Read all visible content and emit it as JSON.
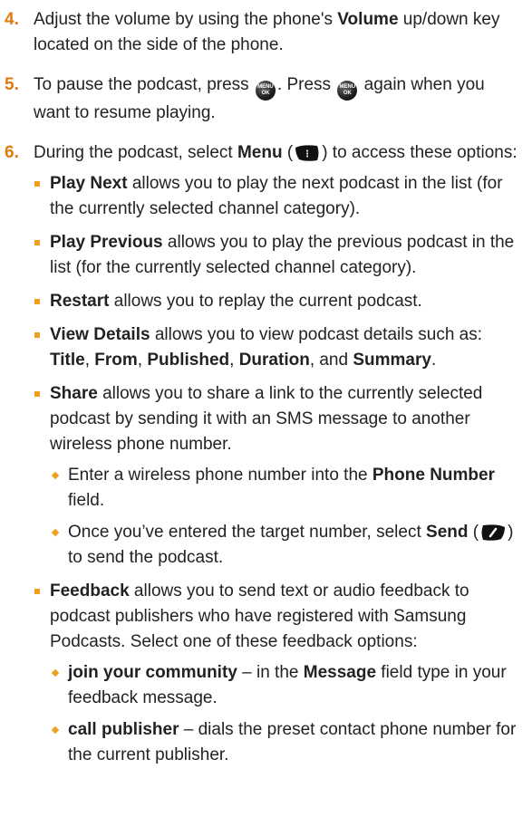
{
  "steps": [
    {
      "number": "4.",
      "pre": "Adjust the volume by using the phone's ",
      "bold": "Volume",
      "post": " up/down key located on the side of the phone."
    },
    {
      "number": "5.",
      "pre": "To pause the podcast, press ",
      "mid": ". Press ",
      "post": " again when you want to resume playing."
    },
    {
      "number": "6.",
      "pre": "During the podcast, select ",
      "bold": "Menu",
      "open": " (",
      "close": ") to access these options:"
    }
  ],
  "menu_key": {
    "line1": "MENU",
    "line2": "OK",
    "icon": "menu-ok-key-icon"
  },
  "softkey_icons": {
    "right": "right-softkey-icon",
    "left": "left-softkey-icon"
  },
  "options": [
    {
      "title": "Play Next",
      "text": " allows you to play the next podcast in the list (for the currently selected channel category)."
    },
    {
      "title": "Play Previous",
      "text": " allows you to play the previous podcast in the list (for the currently selected channel category)."
    },
    {
      "title": "Restart",
      "text": " allows you to replay the current podcast."
    },
    {
      "title": "View Details",
      "text": " allows you to view podcast details such as: ",
      "fields": [
        "Title",
        "From",
        "Published",
        "Duration",
        "Summary"
      ],
      "sep": ", ",
      "and": ", and ",
      "end": "."
    },
    {
      "title": "Share",
      "text": " allows you to share a link to the currently selected podcast by sending it with an SMS message to another wireless phone number.",
      "subs": [
        {
          "pre": "Enter a wireless phone number into the ",
          "bold": "Phone Number",
          "post": " field."
        },
        {
          "pre": "Once you’ve entered the target number, select ",
          "bold": "Send",
          "open": " (",
          "close": ") to send the podcast."
        }
      ]
    },
    {
      "title": "Feedback",
      "text": " allows you to send text or audio feedback to podcast publishers who have registered with Samsung Podcasts. Select one of these feedback options:",
      "subs": [
        {
          "bold": "join your community",
          "mid": " – in the ",
          "bold2": "Message",
          "post": " field type in your feedback message."
        },
        {
          "bold": "call publisher",
          "post": " – dials the preset contact phone number for the current publisher."
        }
      ]
    }
  ]
}
